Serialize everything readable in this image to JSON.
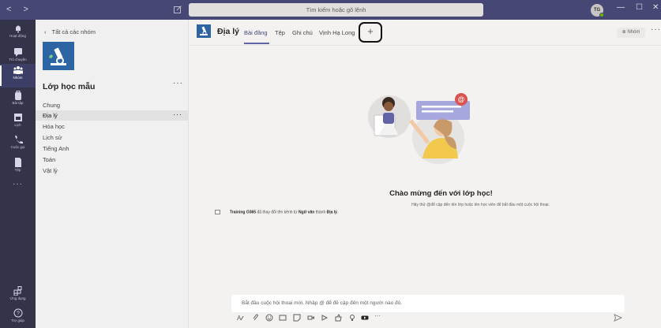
{
  "titlebar": {
    "nav_label": "< >",
    "search_placeholder": "Tìm kiếm hoặc gõ lệnh",
    "avatar_initials": "TG",
    "minimize": "—",
    "maximize": "☐",
    "close": "✕"
  },
  "rail": {
    "items": [
      {
        "label": "Hoạt động",
        "icon": "bell-icon"
      },
      {
        "label": "Trò chuyện",
        "icon": "chat-icon"
      },
      {
        "label": "Nhóm",
        "icon": "teams-icon"
      },
      {
        "label": "Bài tập",
        "icon": "backpack-icon"
      },
      {
        "label": "Lịch",
        "icon": "calendar-icon"
      },
      {
        "label": "Cuộc gọi",
        "icon": "phone-icon"
      },
      {
        "label": "Tệp",
        "icon": "file-icon"
      }
    ],
    "more": "···",
    "apps_label": "Ứng dụng",
    "help_label": "Trợ giúp"
  },
  "panel": {
    "back_label": "Tất cả các nhóm",
    "team_name": "Lớp học mẫu",
    "more": "···",
    "channels": [
      "Chung",
      "Địa lý",
      "Hóa học",
      "Lịch sử",
      "Tiếng Anh",
      "Toán",
      "Vật lý"
    ],
    "selected_channel": "Địa lý"
  },
  "header": {
    "title": "Địa lý",
    "tabs": [
      "Bài đăng",
      "Tệp",
      "Ghi chú",
      "Vịnh Hạ Long"
    ],
    "add_tab": "+",
    "team_button": "⊕ Nhóm",
    "more": "···"
  },
  "welcome": {
    "title": "Chào mừng đến với lớp học!",
    "subtitle": "Hãy thử @để cập đến tên lớp hoặc tên học viên để bắt đầu một cuộc hội thoại.",
    "event_actor": "Training O365",
    "event_mid": " đã thay đổi tên kênh từ ",
    "event_old": "Ngữ văn",
    "event_mid2": " thành ",
    "event_new": "Địa lý",
    "event_end": "."
  },
  "composer": {
    "placeholder": "Bắt đầu cuộc hội thoại mới. Nhập @ để đề cập đến một người nào đó."
  },
  "colors": {
    "titlebar": "#464775",
    "rail": "#33344a",
    "accent": "#6264a7",
    "team_tile": "#2d64a4"
  }
}
